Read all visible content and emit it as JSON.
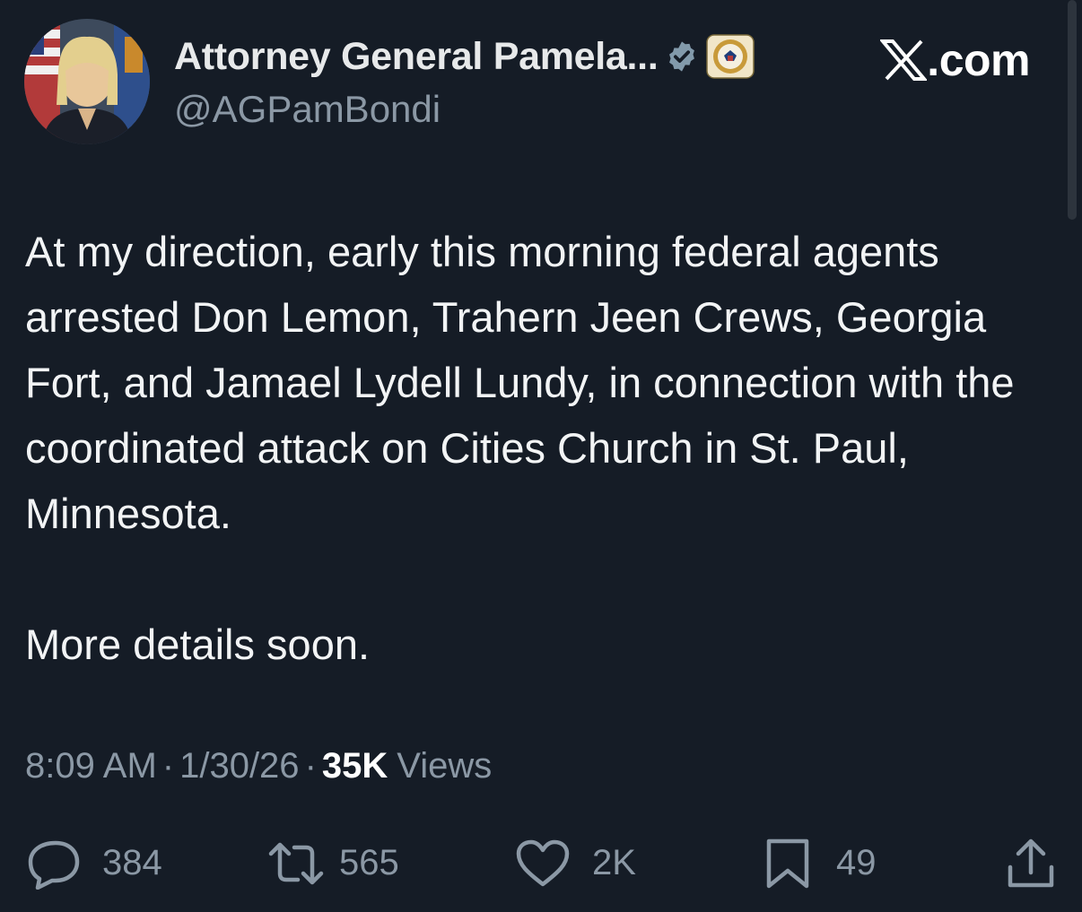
{
  "header": {
    "display_name": "Attorney General Pamela...",
    "handle": "@AGPamBondi",
    "brand": "X.com",
    "icons": [
      "avatar-photo",
      "verified-badge-icon",
      "doj-seal-icon",
      "x-logo"
    ]
  },
  "post": {
    "paragraph1": "At my direction, early this morning federal agents arrested Don Lemon, Trahern Jeen Crews, Georgia Fort, and Jamael Lydell Lundy, in connection with the coordinated attack on Cities Church in St. Paul, Minnesota.",
    "paragraph2": "More details soon.",
    "time": "8:09 AM",
    "date": "1/30/26",
    "separator": "·",
    "views_count": "35K",
    "views_label": "Views"
  },
  "actions": {
    "replies": "384",
    "reposts": "565",
    "likes": "2K",
    "bookmarks": "49"
  },
  "colors": {
    "background": "#151c26",
    "text": "#e7e9ea",
    "secondary": "#8b98a5",
    "verified": "#829aab"
  }
}
